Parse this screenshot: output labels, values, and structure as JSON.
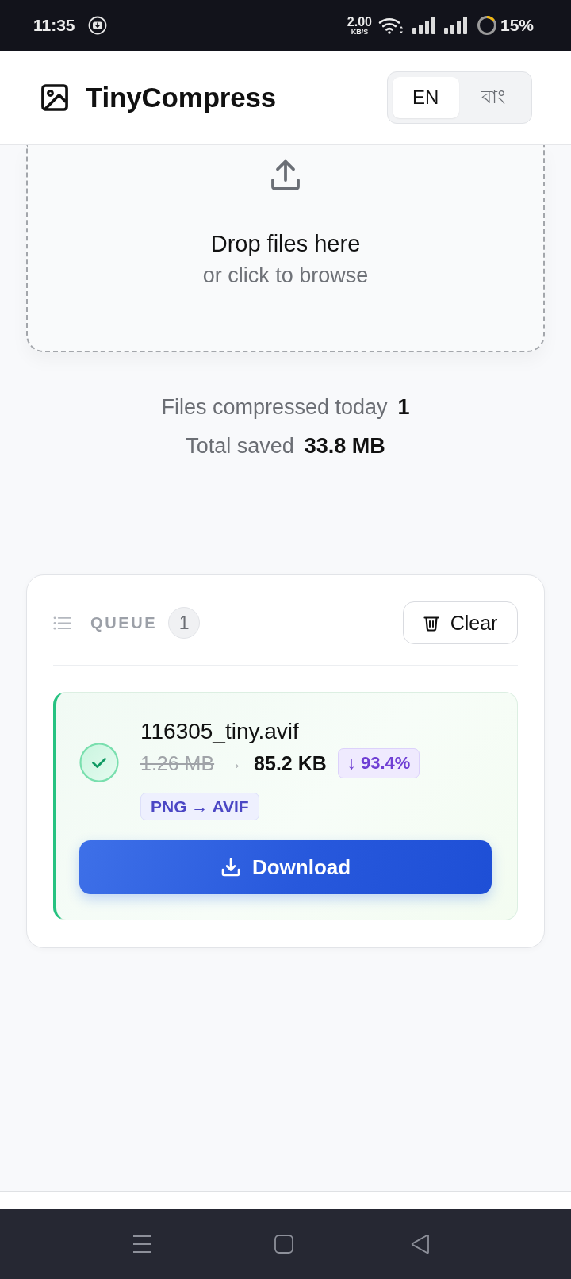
{
  "status_bar": {
    "time": "11:35",
    "network_speed": "2.00",
    "network_unit": "KB/S",
    "battery": "15%"
  },
  "header": {
    "title": "TinyCompress",
    "languages": [
      {
        "label": "EN",
        "selected": true
      },
      {
        "label": "বাং",
        "selected": false
      }
    ]
  },
  "dropzone": {
    "title": "Drop files here",
    "subtitle": "or click to browse"
  },
  "stats": [
    {
      "label": "Files compressed today",
      "value": "1"
    },
    {
      "label": "Total saved",
      "value": "33.8 MB"
    }
  ],
  "queue": {
    "title": "QUEUE",
    "count": "1",
    "clear_button": "Clear",
    "items": [
      {
        "filename": "116305_tiny.avif",
        "completed": true,
        "original_size": "1.26 MB",
        "arrow": "→",
        "new_size": "85.2 KB",
        "reduction": "↓ 93.4%",
        "conversion": "PNG → AVIF",
        "action": "Download"
      }
    ]
  }
}
